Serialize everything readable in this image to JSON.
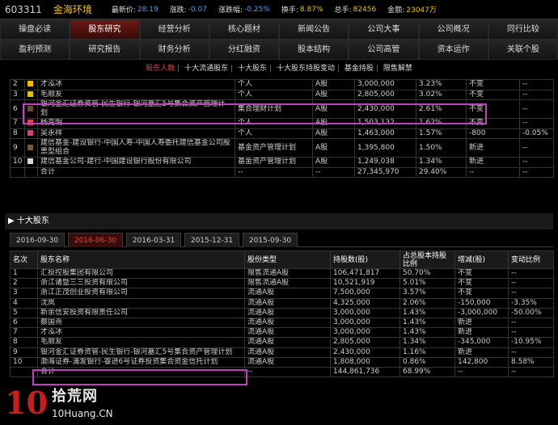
{
  "header": {
    "code": "603311",
    "name": "金海环境",
    "price_label": "最新价:",
    "price": "28.19",
    "change_label": "涨跌:",
    "change": "-0.07",
    "pct_label": "涨跌幅:",
    "pct": "-0.25%",
    "turnover_label": "换手:",
    "turnover": "8.87%",
    "volume_label": "总手:",
    "volume": "82456",
    "amount_label": "金额:",
    "amount": "23047万"
  },
  "nav": {
    "row1": [
      "操盘必读",
      "股东研究",
      "经营分析",
      "核心题材",
      "新闻公告",
      "公司大事",
      "公司概况",
      "同行比较"
    ],
    "row2": [
      "盈利预测",
      "研究报告",
      "财务分析",
      "分红融资",
      "股本结构",
      "公司高管",
      "资本运作",
      "关联个股"
    ],
    "active": "股东研究"
  },
  "subnav": [
    "股东人数",
    "十大流通股东",
    "十大股东",
    "十大股东持股变动",
    "基金持股",
    "限售解禁"
  ],
  "subnav_active": "股东人数",
  "top_table": {
    "rows": [
      {
        "idx": "2",
        "color": "#e8c000",
        "name": "才泓冰",
        "type": "个人",
        "cls": "A股",
        "shares": "3,000,000",
        "pct": "3.23%",
        "chg": "不变",
        "ratio": "--"
      },
      {
        "idx": "3",
        "color": "#e8c000",
        "name": "毛顺友",
        "type": "个人",
        "cls": "A股",
        "shares": "2,805,000",
        "pct": "3.02%",
        "chg": "不变",
        "ratio": "--"
      },
      {
        "idx": "6",
        "color": "#6a4a2a",
        "name": "银河金汇证券资管-民生银行-银河嘉汇5号集合资产管理计划",
        "type": "集合理财计划",
        "cls": "A股",
        "shares": "2,430,000",
        "pct": "2.61%",
        "chg": "不变",
        "ratio": "--"
      },
      {
        "idx": "7",
        "color": "#e0443c",
        "name": "杨克明",
        "type": "个人",
        "cls": "A股",
        "shares": "1,503,132",
        "pct": "1.62%",
        "chg": "不变",
        "ratio": "--"
      },
      {
        "idx": "8",
        "color": "#d04080",
        "name": "吴永祥",
        "type": "个人",
        "cls": "A股",
        "shares": "1,463,000",
        "pct": "1.57%",
        "chg": "-800",
        "ratio": "-0.05%"
      },
      {
        "idx": "9",
        "color": "#7a5a3a",
        "name": "建信基金-建设银行-中国人寿-中国人寿委托建信基金公司股票型组合",
        "type": "基金资产管理计划",
        "cls": "A股",
        "shares": "1,395,800",
        "pct": "1.50%",
        "chg": "新进",
        "ratio": "--"
      },
      {
        "idx": "10",
        "color": "#d8d8d8",
        "name": "建信基金公司-建行-中国建设银行股份有限公司",
        "type": "基金资产管理计划",
        "cls": "A股",
        "shares": "1,249,038",
        "pct": "1.34%",
        "chg": "新进",
        "ratio": "--"
      }
    ],
    "total": {
      "label": "合计",
      "type": "--",
      "cls": "--",
      "shares": "27,345,970",
      "pct": "29.40%",
      "chg": "--",
      "ratio": "--"
    }
  },
  "section_title": "十大股东",
  "date_tabs": [
    "2016-09-30",
    "2016-06-30",
    "2016-03-31",
    "2015-12-31",
    "2015-09-30"
  ],
  "date_tab_active": "2016-06-30",
  "holders_table": {
    "headers": [
      "名次",
      "股东名称",
      "股份类型",
      "持股数(股)",
      "占总股本持股比例",
      "增减(股)",
      "变动比例"
    ],
    "rows": [
      {
        "rank": "1",
        "name": "汇投控股集团有限公司",
        "type": "限售流通A股",
        "shares": "106,471,817",
        "pct": "50.70%",
        "chg": "不变",
        "ratio": "--"
      },
      {
        "rank": "2",
        "name": "浙江诸暨三三投资有限公司",
        "type": "限售流通A股",
        "shares": "10,521,919",
        "pct": "5.01%",
        "chg": "不变",
        "ratio": "--"
      },
      {
        "rank": "3",
        "name": "浙江正茂创业投资有限公司",
        "type": "流通A股",
        "shares": "7,500,000",
        "pct": "3.57%",
        "chg": "不变",
        "ratio": "--"
      },
      {
        "rank": "4",
        "name": "沈岚",
        "type": "流通A股",
        "shares": "4,325,000",
        "pct": "2.06%",
        "chg": "-150,000",
        "ratio": "-3.35%"
      },
      {
        "rank": "5",
        "name": "新余信安投资有限责任公司",
        "type": "流通A股",
        "shares": "3,000,000",
        "pct": "1.43%",
        "chg": "-3,000,000",
        "ratio": "-50.00%"
      },
      {
        "rank": "6",
        "name": "蔡国熹",
        "type": "流通A股",
        "shares": "3,000,000",
        "pct": "1.43%",
        "chg": "新进",
        "ratio": "--"
      },
      {
        "rank": "7",
        "name": "才泓冰",
        "type": "流通A股",
        "shares": "3,000,000",
        "pct": "1.43%",
        "chg": "新进",
        "ratio": "--"
      },
      {
        "rank": "8",
        "name": "毛顺友",
        "type": "流通A股",
        "shares": "2,805,000",
        "pct": "1.34%",
        "chg": "-345,000",
        "ratio": "-10.95%"
      },
      {
        "rank": "9",
        "name": "银河金汇证券资管-民生银行-银河嘉汇5号集合资产管理计划",
        "type": "流通A股",
        "shares": "2,430,000",
        "pct": "1.16%",
        "chg": "新进",
        "ratio": "--"
      },
      {
        "rank": "10",
        "name": "渤海证券-浦发银行-睿进6号证券投资集合资金信托计划",
        "type": "流通A股",
        "shares": "1,808,000",
        "pct": "0.86%",
        "chg": "142,800",
        "ratio": "8.58%"
      }
    ],
    "total": {
      "label": "合计",
      "type": "--",
      "shares": "144,861,736",
      "pct": "68.99%",
      "chg": "--",
      "ratio": "--"
    }
  },
  "watermark": {
    "num": "10",
    "cn": "拾荒网",
    "url": "10Huang.CN"
  },
  "colors": {
    "highlight_box": "#c040c0",
    "up": "#e04040",
    "brand": "#f0c000"
  }
}
